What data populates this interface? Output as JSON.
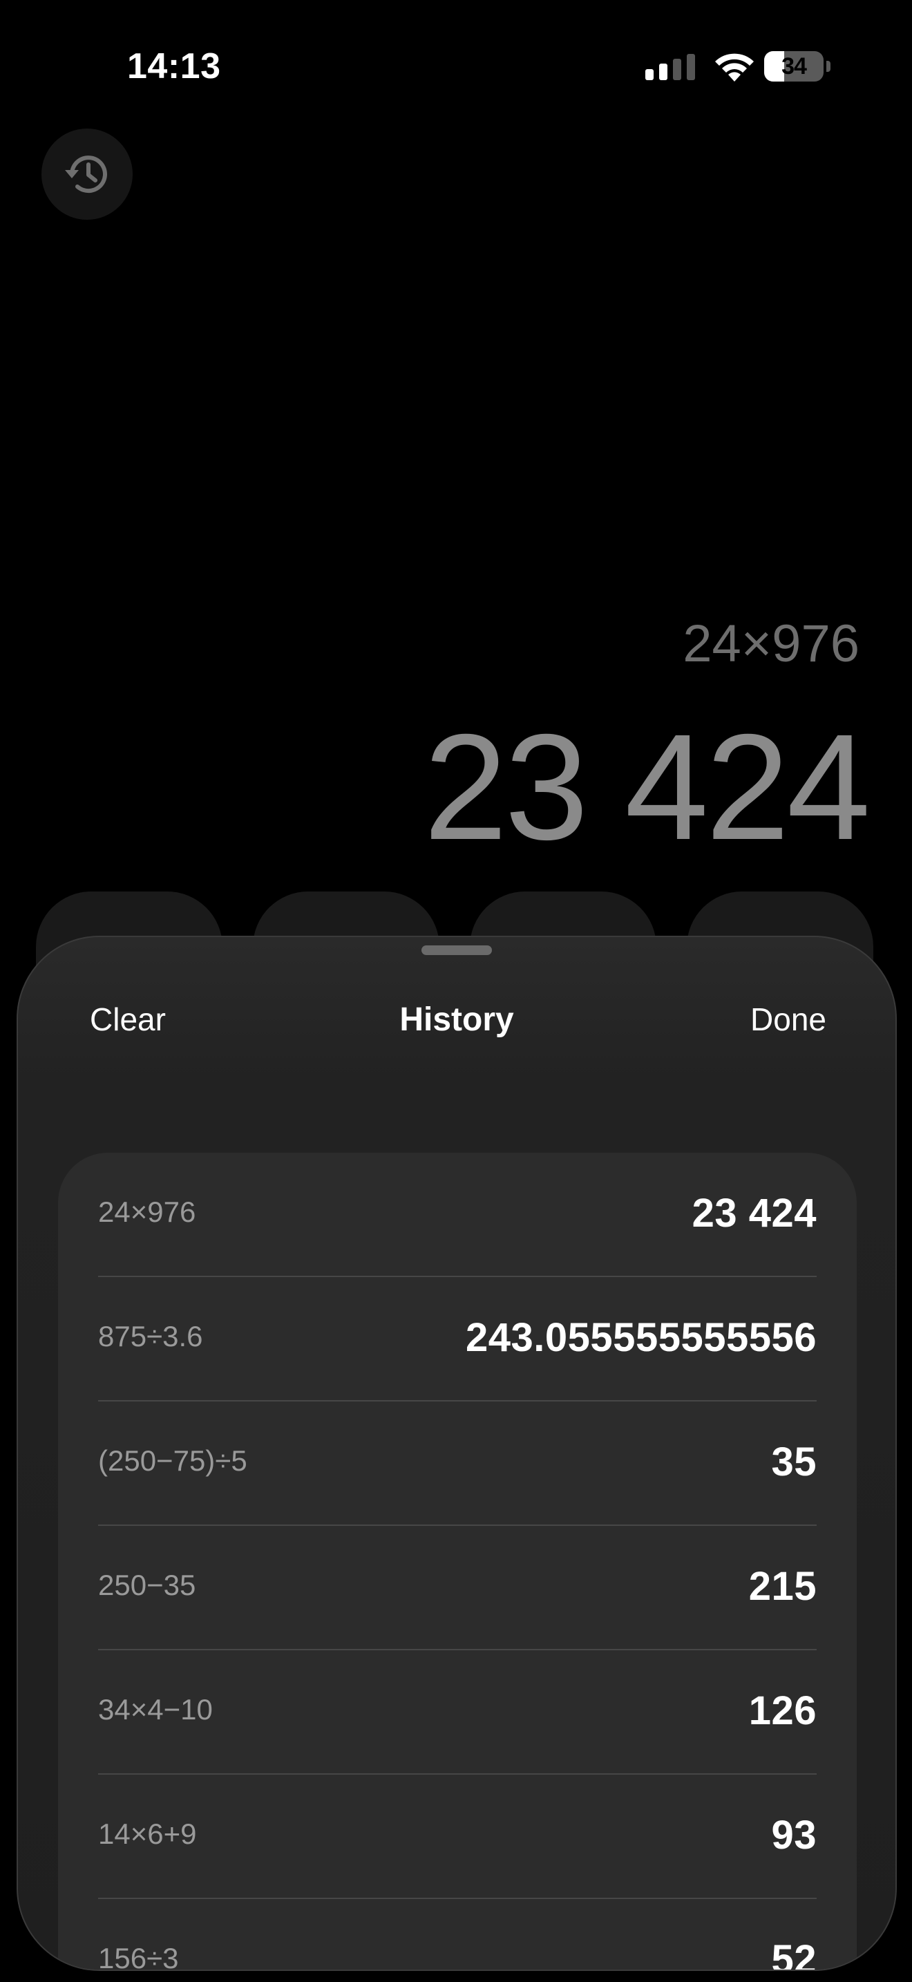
{
  "status_bar": {
    "time": "14:13",
    "battery": "34",
    "battery_level": 0.34,
    "icons": [
      "cellular-signal-icon",
      "wifi-icon",
      "battery-icon"
    ]
  },
  "calculator": {
    "history_icon": "history-icon",
    "expression": "24×976",
    "result": "23 424"
  },
  "history_sheet": {
    "clear_label": "Clear",
    "title": "History",
    "done_label": "Done",
    "entries": [
      {
        "expression": "24×976",
        "result": "23 424"
      },
      {
        "expression": "875÷3.6",
        "result": "243.055555555556"
      },
      {
        "expression": "(250−75)÷5",
        "result": "35"
      },
      {
        "expression": "250−35",
        "result": "215"
      },
      {
        "expression": "34×4−10",
        "result": "126"
      },
      {
        "expression": "14×6+9",
        "result": "93"
      },
      {
        "expression": "156÷3",
        "result": "52"
      }
    ]
  },
  "colors": {
    "background": "#000000",
    "sheet": "#222222",
    "list": "#2c2c2c",
    "secondary_text": "#9a9a9a"
  }
}
